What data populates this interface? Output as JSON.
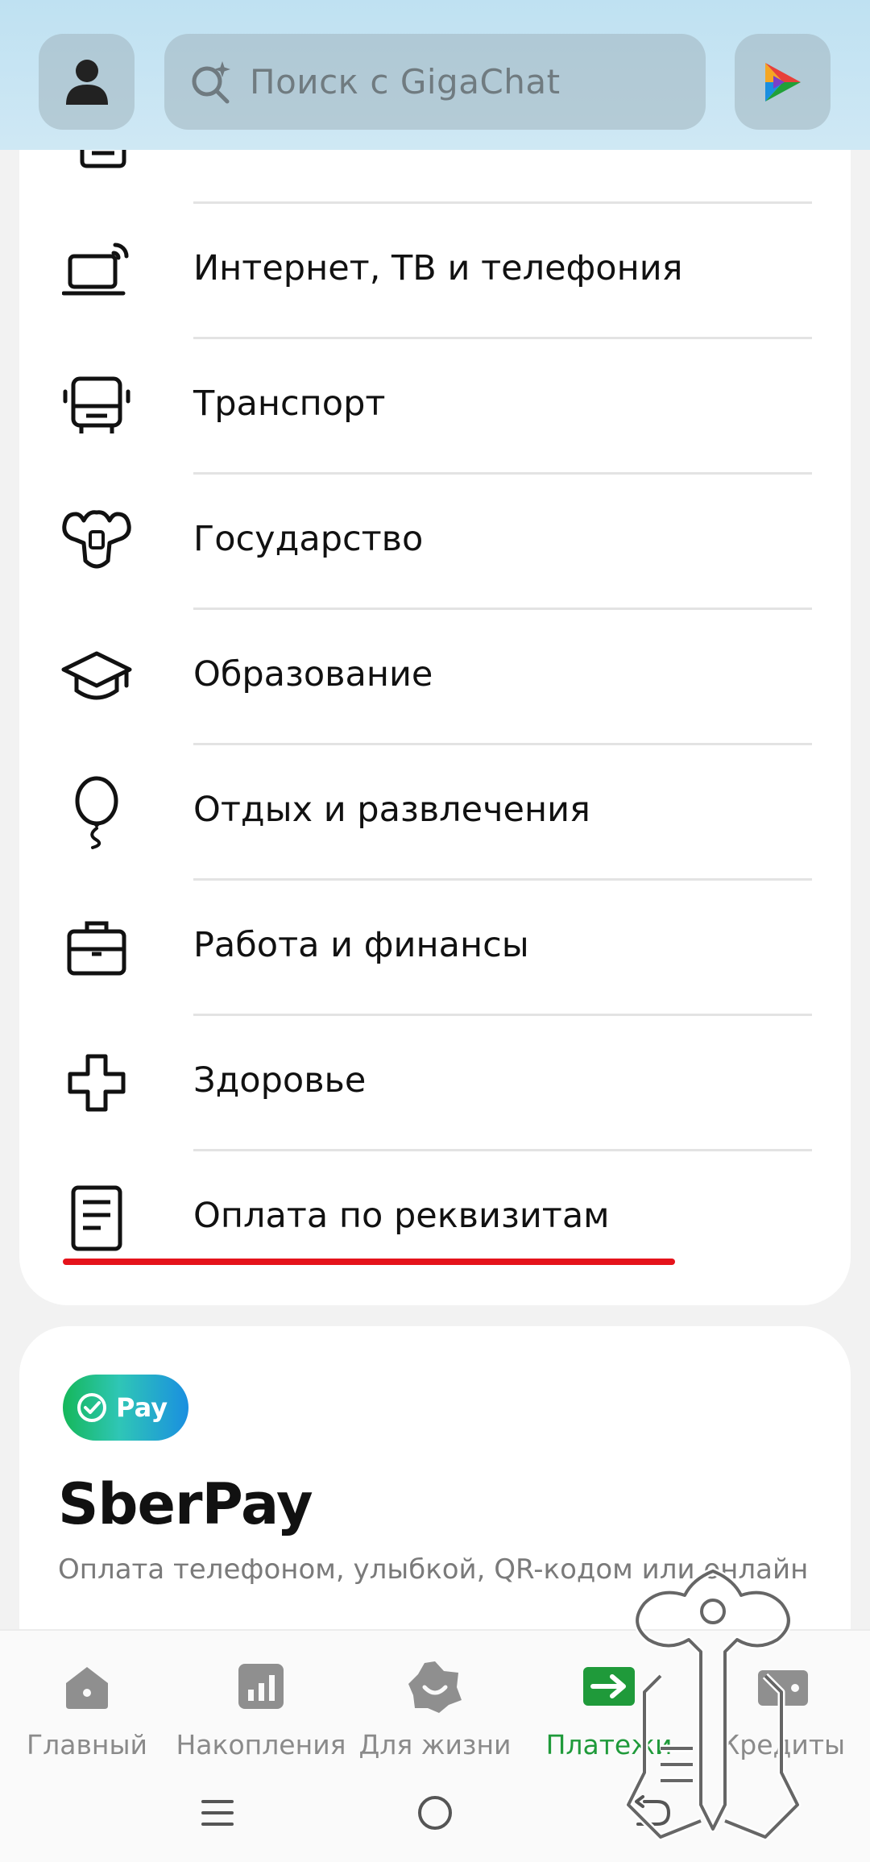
{
  "header": {
    "search_placeholder": "Поиск с GigaChat"
  },
  "categories": [
    {
      "label": "Интернет, ТВ и телефония",
      "icon": "laptop-icon"
    },
    {
      "label": "Транспорт",
      "icon": "bus-icon"
    },
    {
      "label": "Государство",
      "icon": "coat-of-arms-icon"
    },
    {
      "label": "Образование",
      "icon": "graduation-cap-icon"
    },
    {
      "label": "Отдых и развлечения",
      "icon": "balloon-icon"
    },
    {
      "label": "Работа и финансы",
      "icon": "briefcase-icon"
    },
    {
      "label": "Здоровье",
      "icon": "medical-cross-icon"
    },
    {
      "label": "Оплата по реквизитам",
      "icon": "document-icon"
    }
  ],
  "sberpay": {
    "badge": "Pay",
    "title": "SberPay",
    "subtitle": "Оплата телефоном, улыбкой, QR-кодом или онлайн"
  },
  "bottom_nav": [
    {
      "label": "Главный",
      "icon": "home-icon",
      "active": false
    },
    {
      "label": "Накопления",
      "icon": "chart-icon",
      "active": false
    },
    {
      "label": "Для жизни",
      "icon": "smile-flower-icon",
      "active": false
    },
    {
      "label": "Платежи",
      "icon": "transfer-arrow-icon",
      "active": true
    },
    {
      "label": "Кредиты",
      "icon": "wallet-icon",
      "active": false
    }
  ],
  "colors": {
    "accent_green": "#1f9a3a",
    "highlight_red": "#e5131b"
  }
}
